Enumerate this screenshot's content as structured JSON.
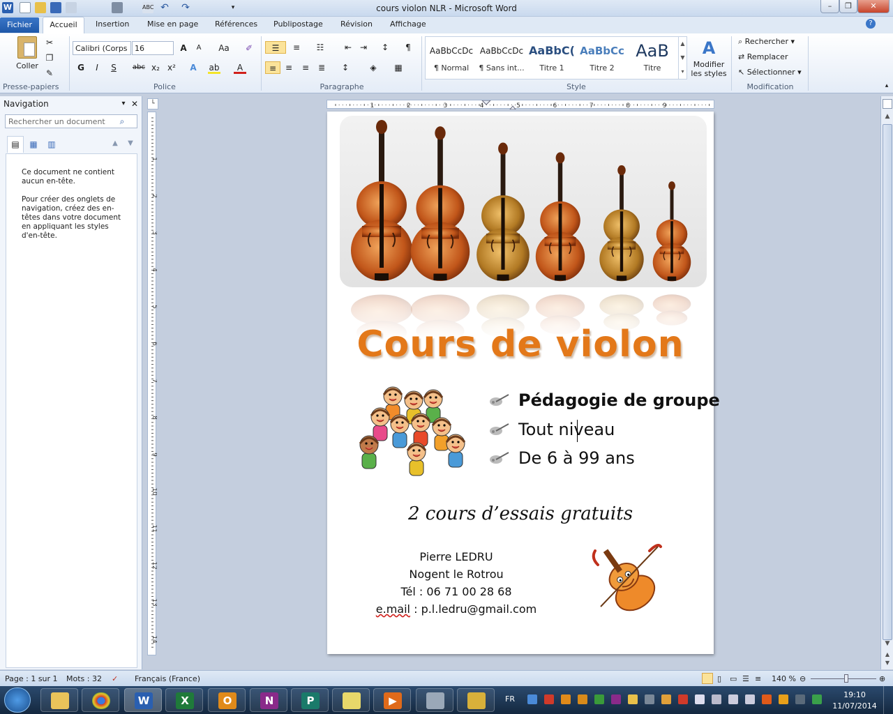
{
  "window": {
    "title": "cours violon NLR - Microsoft Word"
  },
  "tabs": [
    "Fichier",
    "Accueil",
    "Insertion",
    "Mise en page",
    "Références",
    "Publipostage",
    "Révision",
    "Affichage"
  ],
  "ribbon": {
    "clipboard": {
      "paste_label": "Coller",
      "group_label": "Presse-papiers"
    },
    "font": {
      "font_name": "Calibri (Corps",
      "font_size": "16",
      "group_label": "Police",
      "bold": "G",
      "italic": "I",
      "underline": "S"
    },
    "paragraph": {
      "group_label": "Paragraphe"
    },
    "styles": {
      "group_label": "Style",
      "items": [
        {
          "sample": "AaBbCcDc",
          "label": "¶ Normal"
        },
        {
          "sample": "AaBbCcDc",
          "label": "¶ Sans int..."
        },
        {
          "sample": "AaBbC(",
          "label": "Titre 1"
        },
        {
          "sample": "AaBbCc",
          "label": "Titre 2"
        },
        {
          "sample": "AaB",
          "label": "Titre"
        }
      ],
      "change_styles": "Modifier les styles"
    },
    "editing": {
      "group_label": "Modification",
      "find": "Rechercher",
      "replace": "Remplacer",
      "select": "Sélectionner"
    }
  },
  "nav": {
    "title": "Navigation",
    "search_placeholder": "Rechercher un document",
    "message1": "Ce document ne contient aucun en-tête.",
    "message2": "Pour créer des onglets de navigation, créez des en-têtes dans votre document en appliquant les styles d'en-tête."
  },
  "document": {
    "title": "Cours de violon",
    "bullets": [
      "Pédagogie de groupe",
      "Tout niveau",
      "De 6 à 99 ans"
    ],
    "promo": "2 cours d’essais gratuits",
    "contact": {
      "name": "Pierre LEDRU",
      "city": "Nogent le Rotrou",
      "phone": "Tél : 06 71 00 28 68",
      "email_label": "e.mail",
      "email_rest": " : p.l.ledru@gmail.com"
    }
  },
  "status": {
    "page": "Page : 1 sur 1",
    "words": "Mots : 32",
    "language": "Français (France)",
    "zoom": "140 %"
  },
  "taskbar": {
    "lang": "FR",
    "time": "19:10",
    "date": "11/07/2014"
  },
  "colors": {
    "title_orange": "#e37819",
    "ribbon_blue": "#1f58a8"
  }
}
